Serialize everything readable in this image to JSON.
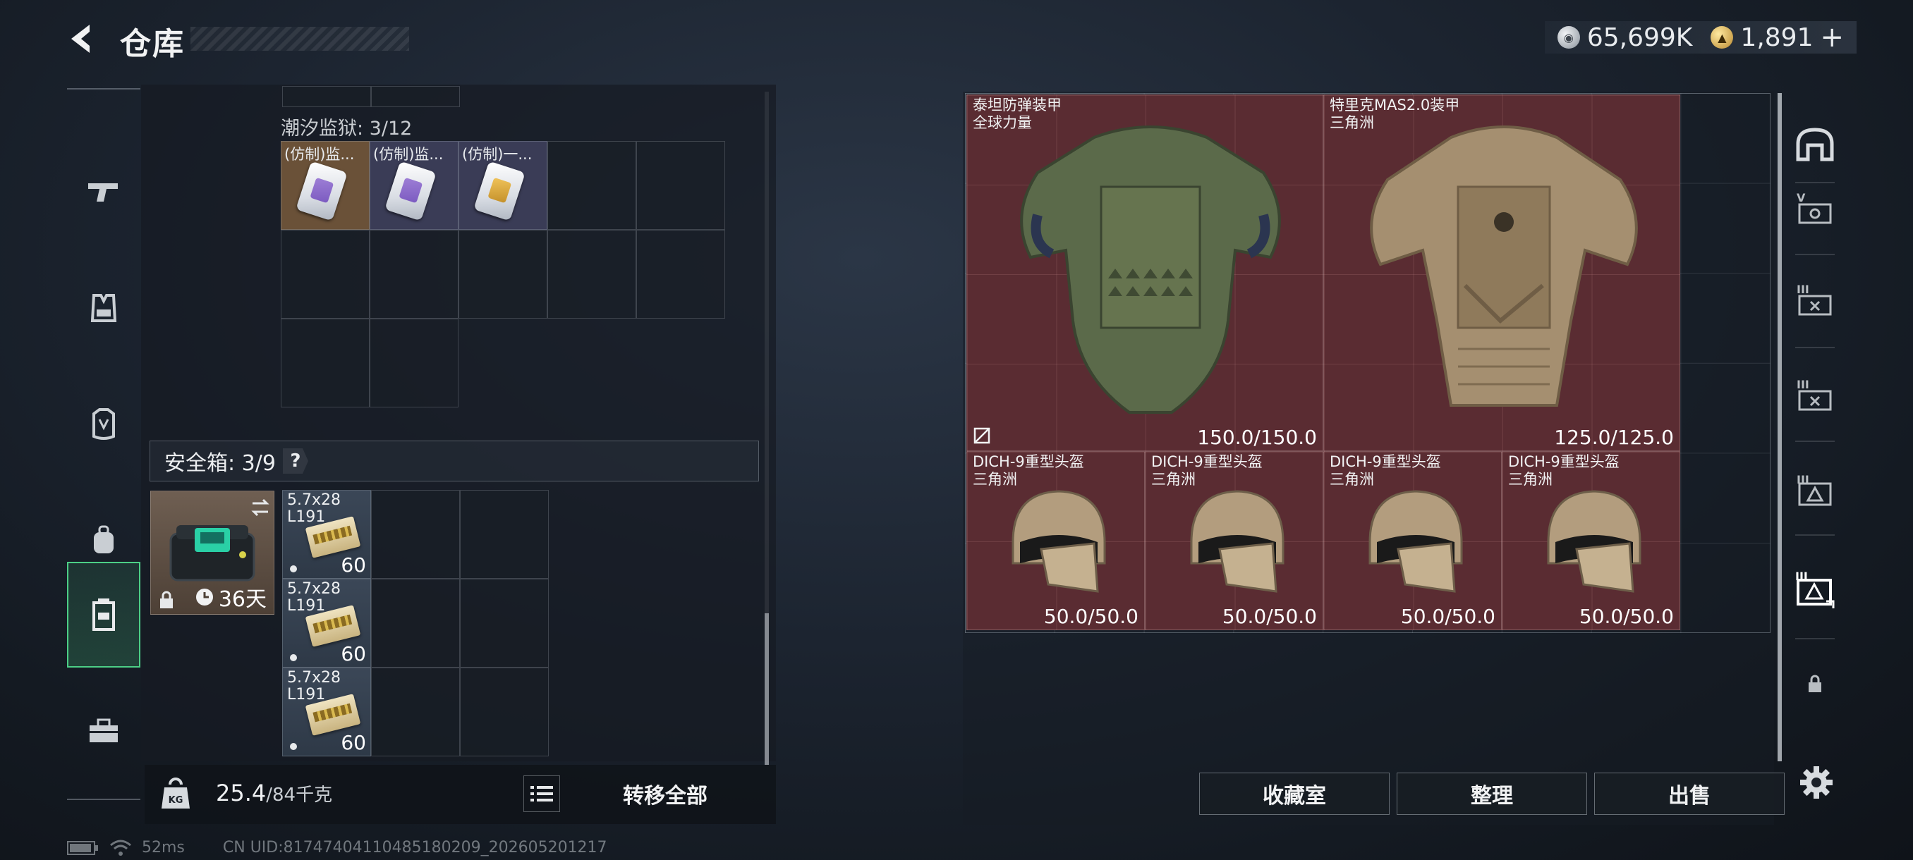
{
  "header": {
    "title": "仓库",
    "currencies": [
      {
        "icon": "silver-coin-icon",
        "value": "65,699K"
      },
      {
        "icon": "gold-coin-icon",
        "value": "1,891"
      }
    ],
    "add_symbol": "+"
  },
  "left_rail": {
    "items": [
      {
        "name": "weapons",
        "icon": "gun-icon"
      },
      {
        "name": "vest",
        "icon": "vest-icon"
      },
      {
        "name": "armor",
        "icon": "armor-icon"
      },
      {
        "name": "backpack",
        "icon": "backpack-icon"
      },
      {
        "name": "safebox",
        "icon": "safebox-icon",
        "active": true
      },
      {
        "name": "toolbox",
        "icon": "toolbox-icon"
      }
    ]
  },
  "inventory": {
    "prison_label": "潮汐监狱: 3/12",
    "prison_items": [
      {
        "name": "(仿制)监...",
        "bg": "#6a5138",
        "card": "purple"
      },
      {
        "name": "(仿制)监...",
        "bg": "#3a3c56",
        "card": "purple"
      },
      {
        "name": "(仿制)一...",
        "bg": "#3a3c56",
        "card": "gold"
      }
    ],
    "safebox_label": "安全箱: 3/9",
    "safebox_help": "?",
    "safebox_days": "36天",
    "ammo": [
      {
        "name_line1": "5.7x28",
        "name_line2": "L191",
        "count": "60"
      },
      {
        "name_line1": "5.7x28",
        "name_line2": "L191",
        "count": "60"
      },
      {
        "name_line1": "5.7x28",
        "name_line2": "L191",
        "count": "60"
      }
    ],
    "weight": "25.4",
    "weight_max": "/84千克",
    "transfer_all": "转移全部"
  },
  "stash": {
    "armors": [
      {
        "name": "泰坦防弹装甲",
        "subtitle": "全球力量",
        "durability": "150.0/150.0",
        "color": "#5b6a4a"
      },
      {
        "name": "特里克MAS2.0装甲",
        "subtitle": "三角洲",
        "durability": "125.0/125.0",
        "color": "#a58f70"
      }
    ],
    "helmets": [
      {
        "name": "DICH-9重型头盔",
        "subtitle": "三角洲",
        "durability": "50.0/50.0"
      },
      {
        "name": "DICH-9重型头盔",
        "subtitle": "三角洲",
        "durability": "50.0/50.0"
      },
      {
        "name": "DICH-9重型头盔",
        "subtitle": "三角洲",
        "durability": "50.0/50.0"
      },
      {
        "name": "DICH-9重型头盔",
        "subtitle": "三角洲",
        "durability": "50.0/50.0"
      }
    ],
    "buttons": {
      "collection": "收藏室",
      "organize": "整理",
      "sell": "出售"
    }
  },
  "right_tabs": [
    {
      "icon": "dome-icon"
    },
    {
      "icon": "stash-v-icon"
    },
    {
      "icon": "stash-iii-icon"
    },
    {
      "icon": "stash-iii-icon"
    },
    {
      "icon": "stash-triangle-icon"
    },
    {
      "icon": "stash-triangle-selected-icon",
      "active": true
    },
    {
      "icon": "lock-icon"
    }
  ],
  "status": {
    "ping": "52ms",
    "uid": "CN UID:817474041104851802​09_202605201217"
  },
  "colors": {
    "accent_green": "#4ccf86",
    "item_red": "#5a2c32"
  }
}
